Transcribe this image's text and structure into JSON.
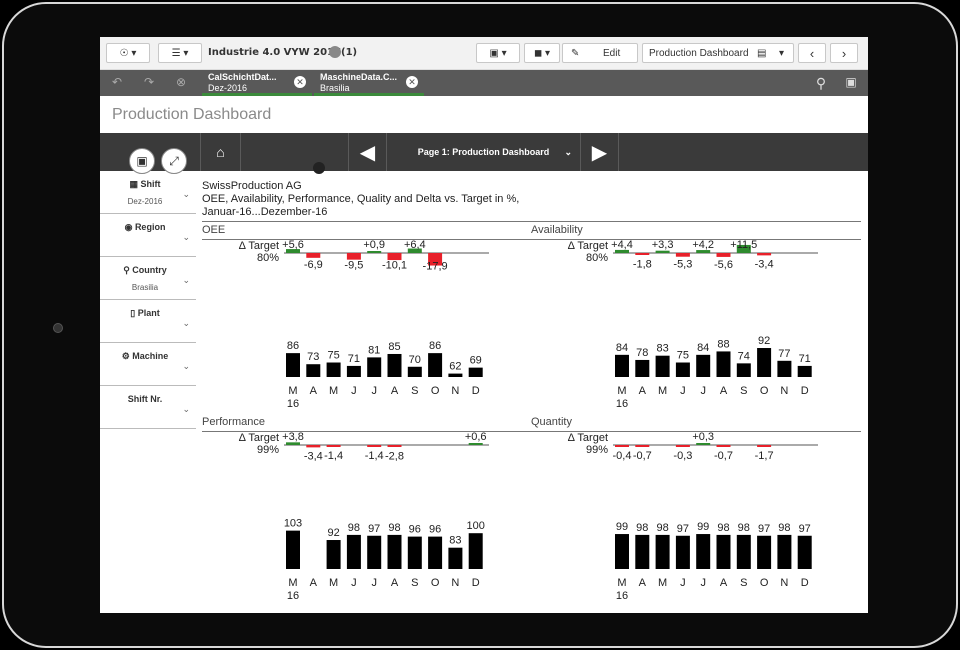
{
  "topbar": {
    "app_title": "Industrie 4.0 VYW 2017(1)",
    "edit_label": "Edit",
    "sheet_selector": "Production Dashboard",
    "icons": [
      "compass-icon",
      "list-icon",
      "present-icon",
      "bookmark-icon",
      "pencil-icon",
      "chart-icon",
      "arrow-left-icon",
      "arrow-right-icon"
    ]
  },
  "selections": [
    {
      "field": "CalSchichtDat...",
      "value": "Dez-2016"
    },
    {
      "field": "MaschineData.C...",
      "value": "Brasilia"
    }
  ],
  "sheet_title": "Production Dashboard",
  "nav": {
    "page_label": "Page 1: Production Dashboard"
  },
  "filters": [
    {
      "label": "Shift",
      "value": "Dez-2016",
      "icon": "calendar-icon"
    },
    {
      "label": "Region",
      "value": "",
      "icon": "globe-icon"
    },
    {
      "label": "Country",
      "value": "Brasilia",
      "icon": "pin-icon"
    },
    {
      "label": "Plant",
      "value": "",
      "icon": "building-icon"
    },
    {
      "label": "Machine",
      "value": "",
      "icon": "gears-icon"
    },
    {
      "label": "Shift Nr.",
      "value": "",
      "icon": ""
    }
  ],
  "report": {
    "company": "SwissProduction AG",
    "subtitle": "OEE, Availability, Performance, Quality and Delta vs. Target in %,",
    "period": "Januar-16...Dezember-16"
  },
  "colors": {
    "positive": "#2e8b2e",
    "negative": "#e8202a",
    "bar": "#000000",
    "nav": "#3a3a3a"
  },
  "chart_data": [
    {
      "type": "bar",
      "title": "OEE",
      "delta_label": "Δ Target",
      "target_label": "80%",
      "categories": [
        "M",
        "A",
        "M",
        "J",
        "J",
        "A",
        "S",
        "O",
        "N",
        "D"
      ],
      "year_label": "16",
      "values": [
        86,
        73,
        75,
        71,
        81,
        85,
        70,
        86,
        62,
        69
      ],
      "deltas": [
        5.6,
        -6.9,
        null,
        -9.5,
        0.9,
        -10.1,
        6.4,
        -17.9,
        null,
        null
      ],
      "delta_labels": [
        "+5,6",
        "-6,9",
        "",
        "-9,5",
        "+0,9",
        "-10,1",
        "+6,4",
        "-17,9",
        "",
        ""
      ]
    },
    {
      "type": "bar",
      "title": "Availability",
      "delta_label": "Δ Target",
      "target_label": "80%",
      "categories": [
        "M",
        "A",
        "M",
        "J",
        "J",
        "A",
        "S",
        "O",
        "N",
        "D"
      ],
      "year_label": "16",
      "values": [
        84,
        78,
        83,
        75,
        84,
        88,
        74,
        92,
        77,
        71
      ],
      "deltas": [
        4.4,
        -1.8,
        3.3,
        -5.3,
        4.2,
        -5.6,
        11.5,
        -3.4,
        null,
        null
      ],
      "delta_labels": [
        "+4,4",
        "-1,8",
        "+3,3",
        "-5,3",
        "+4,2",
        "-5,6",
        "+11,5",
        "-3,4",
        "",
        ""
      ]
    },
    {
      "type": "bar",
      "title": "Performance",
      "delta_label": "Δ Target",
      "target_label": "99%",
      "categories": [
        "M",
        "A",
        "M",
        "J",
        "J",
        "A",
        "S",
        "O",
        "N",
        "D"
      ],
      "year_label": "16",
      "values": [
        103,
        null,
        92,
        98,
        97,
        98,
        96,
        96,
        83,
        100
      ],
      "deltas": [
        3.8,
        -3.4,
        -1.4,
        null,
        -1.4,
        -2.8,
        null,
        null,
        null,
        0.6
      ],
      "delta_labels": [
        "+3,8",
        "-3,4",
        "-1,4",
        "",
        "-1,4",
        "-2,8",
        "",
        "",
        "",
        "+0,6"
      ]
    },
    {
      "type": "bar",
      "title": "Quantity",
      "delta_label": "Δ Target",
      "target_label": "99%",
      "categories": [
        "M",
        "A",
        "M",
        "J",
        "J",
        "A",
        "S",
        "O",
        "N",
        "D"
      ],
      "year_label": "16",
      "values": [
        99,
        98,
        98,
        97,
        99,
        98,
        98,
        97,
        98,
        97
      ],
      "deltas": [
        -0.4,
        -0.7,
        null,
        -0.3,
        0.3,
        -0.7,
        null,
        -1.7,
        null,
        null
      ],
      "delta_labels": [
        "-0,4",
        "-0,7",
        "",
        "-0,3",
        "+0,3",
        "-0,7",
        "",
        "-1,7",
        "",
        ""
      ]
    }
  ]
}
